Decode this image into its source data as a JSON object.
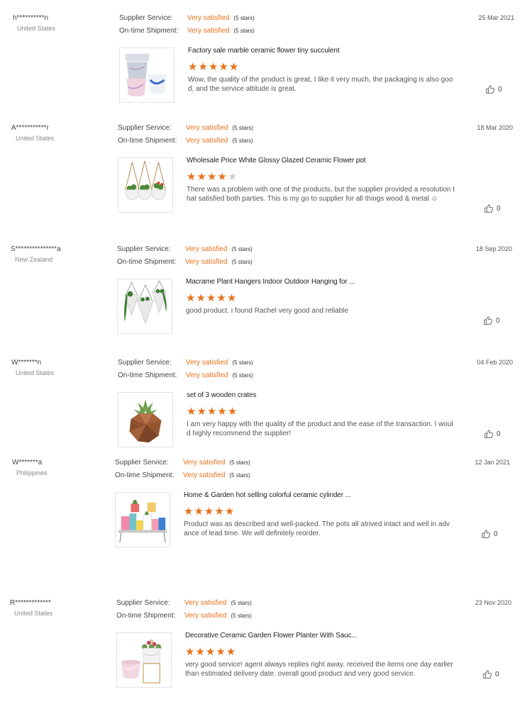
{
  "labels": {
    "supplier_service": "Supplier Service:",
    "ontime_shipment": "On-time Shipment:"
  },
  "colors": {
    "accent": "#e8711b",
    "star_empty": "#cfcfcf"
  },
  "icons": {
    "like": "thumbs-up-icon",
    "star": "star-icon"
  },
  "reviews": [
    {
      "buyer": "h**********n",
      "country": "United States",
      "date": "25 Mar 2021",
      "supplier_service": "Very satisfied",
      "supplier_service_stars": "(5 stars)",
      "ontime_shipment": "Very satisfied",
      "ontime_shipment_stars": "(5 stars)",
      "product_title": "Factory sale marble ceramic flower tiny succulent",
      "rating": 5,
      "comment": "Wow, the quality of the product is great, I like it very much, the packaging is also good, and the service attitude is great.",
      "likes": "0"
    },
    {
      "buyer": "A***********r",
      "country": "United States",
      "date": "18 Mar 2020",
      "supplier_service": "Very satisfied",
      "supplier_service_stars": "(5 stars)",
      "ontime_shipment": "Very satisfied",
      "ontime_shipment_stars": "(5 stars)",
      "product_title": "Wholesale Price White Glossy Glazed Ceramic Flower pot",
      "rating": 4,
      "comment": "There was a problem with one of the products, but the supplier provided a resolution that satisfied both parties. This is my go to supplier for all things wood & metal ☺",
      "likes": "0"
    },
    {
      "buyer": "S***************a",
      "country": "New Zealand",
      "date": "18 Sep 2020",
      "supplier_service": "Very satisfied",
      "supplier_service_stars": "(5 stars)",
      "ontime_shipment": "Very satisfied",
      "ontime_shipment_stars": "(5 stars)",
      "product_title": "Macrame Plant Hangers Indoor Outdoor Hanging for ...",
      "rating": 5,
      "comment": "good product. i found Rachel very good and reliable",
      "likes": "0"
    },
    {
      "buyer": "W*******n",
      "country": "United States",
      "date": "04 Feb 2020",
      "supplier_service": "Very satisfied",
      "supplier_service_stars": "(5 stars)",
      "ontime_shipment": "Very satisfied",
      "ontime_shipment_stars": "(5 stars)",
      "product_title": "set of 3 wooden crates",
      "rating": 5,
      "comment": "I am very happy with the quality of the product and the ease of the transaction. I would highly recommend the supplier!",
      "likes": "0"
    },
    {
      "buyer": "W*******a",
      "country": "Philippines",
      "date": "12 Jan 2021",
      "supplier_service": "Very satisfied",
      "supplier_service_stars": "(5 stars)",
      "ontime_shipment": "Very satisfied",
      "ontime_shipment_stars": "(5 stars)",
      "product_title": "Home & Garden hot selling colorful ceramic cylinder ...",
      "rating": 5,
      "comment": "Product was as described and well-packed. The pots all atrived intact and well in advance of lead time. We will definitely reorder.",
      "likes": "0"
    },
    {
      "buyer": "R*************",
      "country": "United States",
      "date": "23 Nov 2020",
      "supplier_service": "Very satisfied",
      "supplier_service_stars": "(5 stars)",
      "ontime_shipment": "Very satisfied",
      "ontime_shipment_stars": "(5 stars)",
      "product_title": "Decorative Ceramic Garden Flower Planter With Sauc...",
      "rating": 5,
      "comment": "very good service! agent always replies right away. received the items one day earlier than estimated delivery date. overall good product and very good service.",
      "likes": "0"
    }
  ]
}
